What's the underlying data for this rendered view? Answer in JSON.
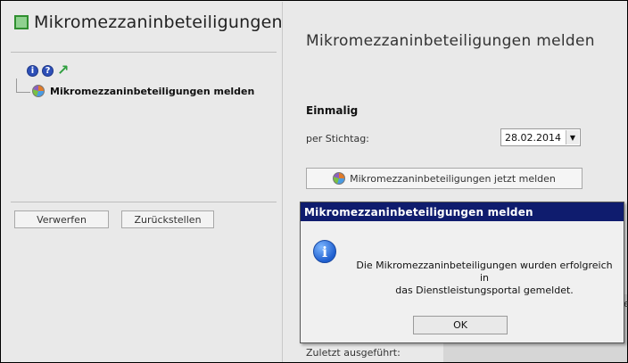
{
  "left": {
    "title": "Mikromezzaninbeteiligungen",
    "icons": {
      "info": "i",
      "help": "?"
    },
    "tree_item": "Mikromezzaninbeteiligungen melden",
    "buttons": {
      "verwerfen": "Verwerfen",
      "zurueckstellen": "Zurückstellen"
    }
  },
  "right": {
    "title": "Mikromezzaninbeteiligungen melden",
    "section": "Einmalig",
    "stichtag_label": "per Stichtag:",
    "stichtag_value": "28.02.2014",
    "report_button": "Mikromezzaninbeteiligungen jetzt melden",
    "last_run_label": "Zuletzt ausgeführt:",
    "cut_text": "er"
  },
  "dialog": {
    "title": "Mikromezzaninbeteiligungen melden",
    "message_line1": "Die Mikromezzaninbeteiligungen wurden erfolgreich in",
    "message_line2": "das Dienstleistungsportal gemeldet.",
    "ok": "OK"
  },
  "colors": {
    "dialog_title_bg": "#0f1c6e",
    "app_icon": "#2f8f2f",
    "arrow": "#2f9f3f",
    "info_icon": "#1f5fcf"
  }
}
